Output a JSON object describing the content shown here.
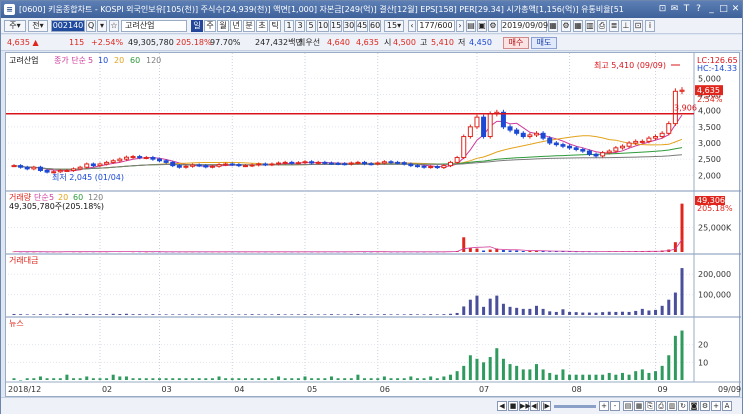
{
  "title_bar": {
    "text": "[0600] 키움종합차트 - KOSPI 외국인보유[105(천)] 주식수[24,939(천)] 액면[1,000] 자본금[249(억)] 결산[12월] EPS[158] PER[29.34] 시가총액[1,156(억)] 유통비율[51",
    "win_buttons": [
      "⊡",
      "✉",
      "T",
      "?",
      "_",
      "□",
      "✕"
    ]
  },
  "toolbar1": {
    "period_select": "주",
    "prev_label": "전",
    "code_value": "002140",
    "stock_name": "고려산업",
    "timeframes": [
      "일",
      "주",
      "월",
      "년",
      "분",
      "초",
      "틱"
    ],
    "intervals": [
      "1",
      "3",
      "5",
      "10",
      "15",
      "30",
      "45",
      "60",
      "15"
    ],
    "page_counter": "177/600",
    "date_value": "2019/09/09",
    "right_icons": [
      "gear-icon",
      "grid-icon",
      "chart-icon",
      "print-icon",
      "list-icon",
      "pin-icon",
      "lock-icon",
      "info-icon"
    ]
  },
  "toolbar2": {
    "price": "4,635",
    "change_arrow": "▲",
    "change": "115",
    "change_pct": "+2.54%",
    "volume": "49,305,780",
    "volume_ratio": "205.18%",
    "strength": "97.70%",
    "trade_value": "247,432백만",
    "best_ask_label": "최우선",
    "best_ask": "4,640",
    "best_bid": "4,635",
    "open_label": "시",
    "open": "4,500",
    "high_label": "고",
    "high": "5,410",
    "low_label": "저",
    "low": "4,450",
    "buy_label": "매수",
    "sell_label": "매도"
  },
  "chart_data": [
    {
      "type": "line",
      "panel": "price",
      "title": "고려산업",
      "legend": [
        "종가 단순",
        "5",
        "10",
        "20",
        "60",
        "120"
      ],
      "legend_colors": [
        "#d0399b",
        "#d0399b",
        "#1c49d6",
        "#e3a31a",
        "#2e9a3a",
        "#7b7b7b"
      ],
      "x": [
        "2018/12",
        "02",
        "03",
        "04",
        "05",
        "06",
        "07",
        "08",
        "09"
      ],
      "close": [
        2300,
        2250,
        2200,
        2250,
        2150,
        2100,
        2110,
        2150,
        2150,
        2200,
        2250,
        2350,
        2300,
        2350,
        2400,
        2450,
        2500,
        2560,
        2580,
        2550,
        2550,
        2500,
        2450,
        2400,
        2300,
        2250,
        2280,
        2320,
        2300,
        2260,
        2280,
        2330,
        2350,
        2330,
        2300,
        2300,
        2320,
        2350,
        2330,
        2350,
        2380,
        2400,
        2380,
        2390,
        2420,
        2380,
        2400,
        2380,
        2370,
        2360,
        2350,
        2380,
        2400,
        2360,
        2350,
        2380,
        2420,
        2400,
        2390,
        2350,
        2300,
        2280,
        2250,
        2270,
        2240,
        2300,
        2400,
        2550,
        3200,
        3500,
        3800,
        3200,
        3900,
        3950,
        3500,
        3400,
        3300,
        3200,
        3250,
        3300,
        3150,
        3000,
        2950,
        2900,
        2850,
        2800,
        2750,
        2650,
        2600,
        2700,
        2750,
        2850,
        2900,
        3000,
        3050,
        3050,
        3150,
        3200,
        3300,
        3600,
        4600,
        4635
      ],
      "annotations": [
        "최고 5,410 (09/09)",
        "최저 2,045 (01/04)"
      ],
      "horizontal_line": 3906,
      "horizontal_line_label": "3,906",
      "right_labels": {
        "lc": "LC:126.65",
        "hc": "HC:-14.33",
        "price_tag": "4,635",
        "pct_tag": "2.54%"
      },
      "y_ticks": [
        "5,000",
        "4,500",
        "4,000",
        "3,500",
        "3,000",
        "2,500",
        "2,000"
      ],
      "ylim": [
        1700,
        5600
      ]
    },
    {
      "type": "bar",
      "panel": "volume",
      "title": "거래량",
      "legend": [
        "단순",
        "5",
        "20",
        "60",
        "120"
      ],
      "legend_colors": [
        "#d0399b",
        "#d0399b",
        "#e3a31a",
        "#2e9a3a",
        "#7b7b7b"
      ],
      "subtitle": "49,305,780주(205.18%)",
      "values": [
        0.4,
        0.3,
        0.2,
        0.2,
        0.3,
        0.2,
        0.2,
        0.3,
        0.5,
        0.3,
        0.2,
        0.4,
        0.3,
        0.3,
        0.3,
        0.5,
        0.4,
        0.5,
        0.3,
        0.3,
        0.2,
        0.3,
        0.2,
        0.2,
        0.2,
        0.2,
        0.2,
        0.2,
        0.2,
        0.2,
        0.2,
        0.2,
        0.2,
        0.2,
        0.2,
        0.2,
        0.3,
        0.2,
        0.2,
        0.2,
        0.3,
        0.2,
        0.2,
        0.2,
        0.3,
        0.2,
        0.2,
        0.2,
        0.3,
        0.2,
        0.2,
        0.3,
        0.4,
        0.2,
        0.2,
        0.2,
        0.3,
        0.2,
        0.2,
        0.2,
        0.3,
        0.2,
        0.2,
        0.3,
        0.2,
        0.3,
        0.5,
        1.0,
        15.0,
        4.0,
        3.5,
        1.5,
        2.5,
        3.5,
        2.0,
        1.5,
        1.5,
        1.0,
        1.0,
        1.5,
        1.0,
        0.5,
        0.5,
        1.0,
        0.5,
        0.4,
        0.4,
        0.4,
        0.4,
        0.5,
        0.6,
        0.5,
        0.6,
        0.5,
        0.7,
        1.0,
        0.7,
        0.8,
        1.5,
        2.5,
        10.0,
        49.3
      ],
      "price_tag": "49,306K",
      "pct_tag": "205.18%",
      "y_ticks": [
        "25,000K"
      ]
    },
    {
      "type": "bar",
      "panel": "trade_value",
      "title": "거래대금",
      "values": [
        5,
        4,
        3,
        3,
        4,
        3,
        3,
        4,
        6,
        4,
        3,
        5,
        4,
        4,
        4,
        6,
        5,
        6,
        4,
        4,
        3,
        4,
        3,
        3,
        3,
        3,
        3,
        3,
        3,
        3,
        3,
        3,
        3,
        3,
        3,
        3,
        4,
        3,
        3,
        3,
        4,
        3,
        3,
        3,
        4,
        3,
        3,
        3,
        4,
        3,
        3,
        4,
        5,
        3,
        3,
        3,
        4,
        3,
        3,
        3,
        4,
        3,
        3,
        4,
        3,
        4,
        6,
        10,
        42,
        75,
        95,
        40,
        80,
        95,
        55,
        40,
        35,
        30,
        30,
        45,
        30,
        18,
        15,
        28,
        15,
        14,
        12,
        12,
        11,
        14,
        16,
        15,
        16,
        15,
        20,
        30,
        22,
        25,
        45,
        75,
        110,
        230
      ],
      "y_ticks": [
        "200,000",
        "100,000"
      ]
    },
    {
      "type": "bar",
      "panel": "news",
      "title": "뉴스",
      "values": [
        1,
        0,
        1,
        1,
        2,
        1,
        1,
        1,
        3,
        1,
        1,
        2,
        1,
        1,
        1,
        3,
        2,
        2,
        1,
        1,
        1,
        1,
        1,
        1,
        1,
        1,
        1,
        1,
        1,
        1,
        1,
        2,
        1,
        1,
        1,
        1,
        1,
        1,
        1,
        1,
        2,
        1,
        1,
        1,
        2,
        1,
        1,
        1,
        2,
        1,
        1,
        1,
        3,
        1,
        1,
        1,
        2,
        1,
        1,
        1,
        2,
        1,
        1,
        2,
        1,
        2,
        3,
        5,
        8,
        14,
        12,
        10,
        13,
        18,
        12,
        9,
        8,
        6,
        6,
        9,
        6,
        4,
        3,
        6,
        3,
        3,
        3,
        3,
        3,
        3,
        4,
        3,
        4,
        3,
        5,
        6,
        4,
        5,
        8,
        14,
        25,
        28
      ],
      "y_ticks": [
        "20",
        "10"
      ]
    }
  ],
  "x_axis": {
    "labels": [
      "2018/12",
      "02",
      "03",
      "04",
      "05",
      "06",
      "07",
      "08",
      "09"
    ],
    "right_label": "09/09"
  },
  "navbar": {
    "buttons": [
      "◀",
      "■",
      "▶▶",
      "◀|",
      "|▶",
      "+",
      "-"
    ]
  }
}
